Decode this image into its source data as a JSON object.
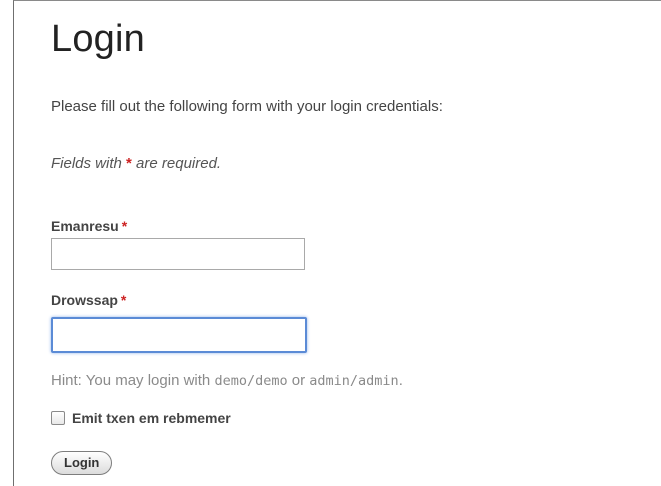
{
  "page": {
    "title": "Login",
    "intro": "Please fill out the following form with your login credentials:",
    "required_note_prefix": "Fields with",
    "required_marker": "*",
    "required_note_suffix": "are required."
  },
  "form": {
    "username": {
      "label": "Emanresu",
      "value": "",
      "placeholder": ""
    },
    "password": {
      "label": "Drowssap",
      "value": "",
      "placeholder": "",
      "focused": true
    },
    "hint": {
      "prefix": "Hint: You may login with",
      "cred1": "demo/demo",
      "middle": "or",
      "cred2": "admin/admin",
      "suffix": "."
    },
    "remember": {
      "label": "Emit txen em rebmemer",
      "checked": false
    },
    "submit_label": "Login"
  },
  "colors": {
    "required": "#cc2222",
    "focus_border": "#5b8bd6",
    "hint_text": "#8a8a8a"
  }
}
